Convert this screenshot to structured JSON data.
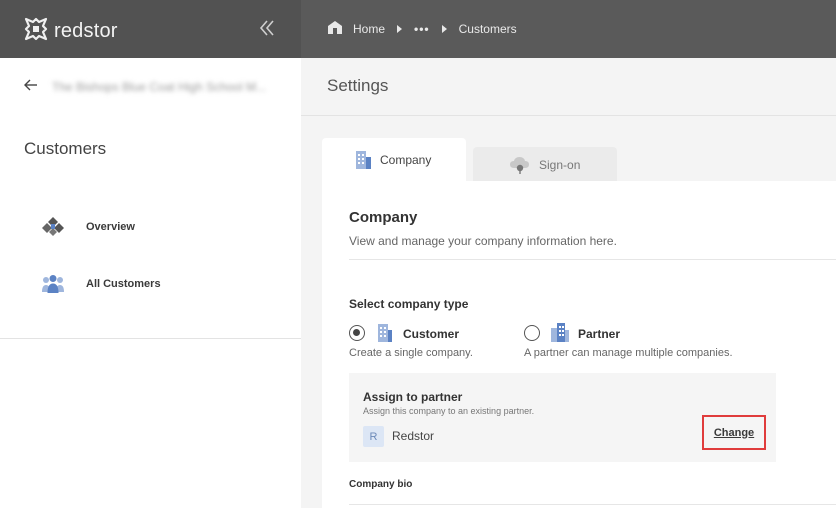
{
  "brand": {
    "name": "redstor",
    "logo_icon": "redstor-logo-icon",
    "header_color": "#525252"
  },
  "sidebar": {
    "collapse_icon": "double-chevron-left-icon",
    "back_icon": "arrow-left-icon",
    "account_name": "The Bishops Blue Coat High School M...",
    "section_title": "Customers",
    "items": [
      {
        "label": "Overview",
        "icon": "overview-icon"
      },
      {
        "label": "All Customers",
        "icon": "people-group-icon"
      }
    ]
  },
  "breadcrumb": {
    "home_icon": "home-icon",
    "home": "Home",
    "ellipsis": "•••",
    "current": "Customers"
  },
  "page": {
    "title": "Settings"
  },
  "tabs": [
    {
      "label": "Company",
      "icon": "building-icon",
      "active": true
    },
    {
      "label": "Sign-on",
      "icon": "cloud-key-icon",
      "active": false
    }
  ],
  "company": {
    "heading": "Company",
    "description": "View and manage your company information here.",
    "type_label": "Select company type",
    "options": [
      {
        "label": "Customer",
        "description": "Create a single company.",
        "selected": true,
        "icon": "building-icon"
      },
      {
        "label": "Partner",
        "description": "A partner can manage multiple companies.",
        "selected": false,
        "icon": "buildings-icon"
      }
    ],
    "assign": {
      "title": "Assign to partner",
      "subtitle": "Assign this company to an existing partner.",
      "avatar_letter": "R",
      "partner": "Redstor",
      "change_label": "Change"
    },
    "bio_label": "Company bio"
  },
  "colors": {
    "accent_blue": "#5b82c4",
    "highlight_red": "#e03c3c"
  }
}
